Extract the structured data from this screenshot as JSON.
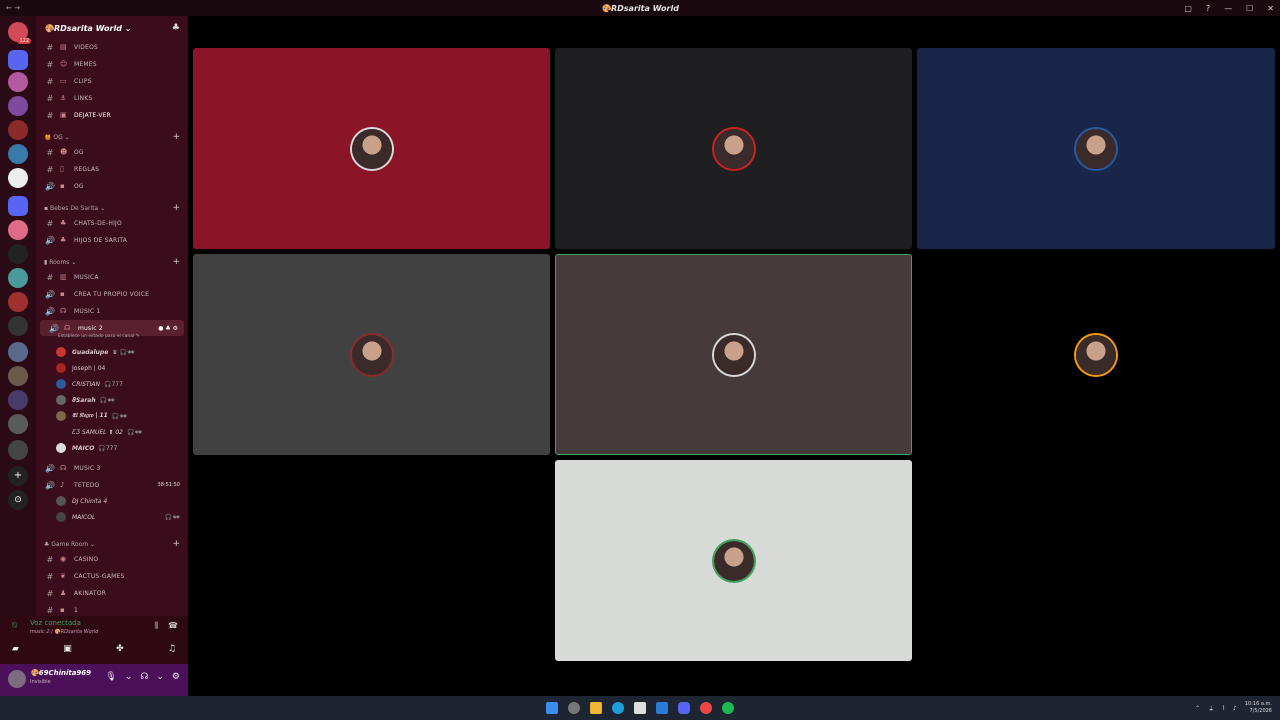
{
  "window": {
    "title": "🎨RDsarita World",
    "left_text": "← →"
  },
  "guild": {
    "name": "🎨RDsarita World ⌄"
  },
  "channels_top": [
    {
      "type": "text",
      "emoji": "▤",
      "name": "VIDEOS"
    },
    {
      "type": "text",
      "emoji": "☺",
      "name": "MEMES"
    },
    {
      "type": "text",
      "emoji": "▭",
      "name": "CLIPS"
    },
    {
      "type": "text",
      "emoji": "⚓",
      "name": "LINKS"
    },
    {
      "type": "text",
      "emoji": "▣",
      "name": "DEJATE-VER"
    }
  ],
  "categories": {
    "og": {
      "label": "🍯 OG ⌄",
      "channels": [
        {
          "type": "text",
          "emoji": "☻",
          "name": "OG"
        },
        {
          "type": "text",
          "emoji": "▯",
          "name": "REGLAS"
        },
        {
          "type": "voice",
          "emoji": "▪",
          "name": "OG"
        }
      ]
    },
    "bebes": {
      "label": "▪ Bebes De Sarita ⌄",
      "channels": [
        {
          "type": "text",
          "emoji": "♣",
          "name": "CHATS-DE-HIJO"
        },
        {
          "type": "voice",
          "emoji": "♣",
          "name": "HIJOS DE SARITA"
        }
      ]
    },
    "rooms": {
      "label": "▮ Rooms ⌄",
      "channels": [
        {
          "type": "text",
          "emoji": "▥",
          "name": "MUSICA"
        },
        {
          "type": "voice",
          "emoji": "▪",
          "name": "CREA TU PROPIO VOICE"
        },
        {
          "type": "voice",
          "emoji": "☊",
          "name": "MUSIC 1"
        },
        {
          "type": "voice",
          "emoji": "☊",
          "name": "music 2"
        }
      ]
    },
    "game": {
      "label": "♣ Game Room ⌄",
      "channels": [
        {
          "type": "text",
          "emoji": "◉",
          "name": "CASINO"
        },
        {
          "type": "text",
          "emoji": "❦",
          "name": "CACTUS-GAMES"
        },
        {
          "type": "text",
          "emoji": "♟",
          "name": "AKINATOR"
        },
        {
          "type": "text",
          "emoji": "▪",
          "name": "1"
        }
      ]
    }
  },
  "music2_status": "Establece un estado para el canal ✎",
  "music2_users": [
    {
      "name": "Guadalupe",
      "extra": "♛ 🎧🕶"
    },
    {
      "name": "Joseph | 04",
      "extra": ""
    },
    {
      "name": "CRISTIAN",
      "extra": "🎧777"
    },
    {
      "name": "ϑSarah",
      "extra": "🎧🕶"
    },
    {
      "name": "𝔈𝔩 𝔑𝔢𝔤𝔯𝔬 | 11",
      "extra": "🎧🕶"
    },
    {
      "name": "ƸƷ SAMUEL ⬆ 02",
      "extra": "🎧🕶"
    },
    {
      "name": "MAICO",
      "extra": "🎧777"
    }
  ],
  "music3": {
    "name": "MUSIC 3"
  },
  "tetedo": {
    "name": "TETEDO",
    "time": "38:51:50"
  },
  "tetedo_users": [
    {
      "name": "DJ Chinita 4",
      "extra": ""
    },
    {
      "name": "MAICOL",
      "extra": "🎧🕶"
    }
  ],
  "voice": {
    "connected": "Voz conectada",
    "channel": "music 2 / 🎨RDsarita World"
  },
  "user": {
    "name": "🎨69Chinita969",
    "status": "Invisible"
  },
  "tiles": [
    {
      "color": "#8b1427",
      "ring": "#d9d9d9"
    },
    {
      "color": "#1f1f22",
      "ring": "#c22"
    },
    {
      "color": "#172649",
      "ring": "#2a5aa0"
    },
    {
      "color": "#414142",
      "ring": "#8b2b2b"
    },
    {
      "color": "#463a3c",
      "ring": "#d9d9d9"
    },
    {
      "color": "#000000",
      "ring": "#f39c12"
    },
    {
      "color": "#d8dad8",
      "ring": "#3ba55c"
    }
  ],
  "taskbar": {
    "time": "10:16 a.m.",
    "date": "7/5/2026"
  }
}
